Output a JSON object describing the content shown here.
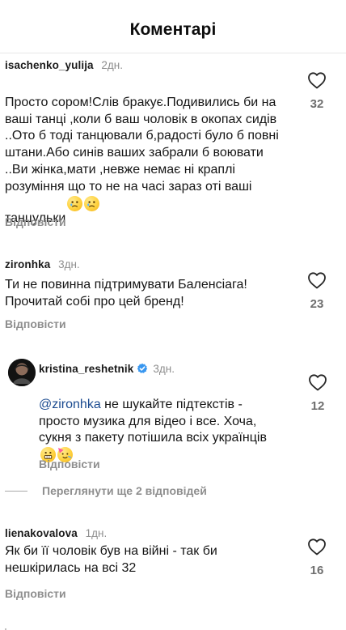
{
  "header": {
    "title": "Коментарі"
  },
  "comments": [
    {
      "username": "isachenko_yulija",
      "time": "2дн.",
      "text": "Просто сором!Слів бракує.Подивились би на ваші танці ,коли б ваш чоловік в окопах сидів ..Ото б тоді танцювали б,радості було б повні штани.Або синів ваших забрали б воювати ..Ви жінка,мати ,невже немає ні краплі розуміння що то не на часі зараз оті ваші танцульки",
      "reply_label": "Відповісти",
      "likes": "32"
    },
    {
      "username": "zironhka",
      "time": "3дн.",
      "text": "Ти не повинна підтримувати Баленсіага! Прочитай собі про цей бренд!",
      "reply_label": "Відповісти",
      "likes": "23"
    },
    {
      "username": "kristina_reshetnik",
      "time": "3дн.",
      "mention": "@zironhka",
      "text": " не шукайте підтекстів - просто музика для відео і все. Хоча, сукня з пакету потішила всіх українців",
      "reply_label": "Відповісти",
      "likes": "12"
    },
    {
      "username": "lienakovalova",
      "time": "1дн.",
      "text": "Як би її чоловік був на війні - так би нешкірилась на всі 32",
      "reply_label": "Відповісти",
      "likes": "16"
    }
  ],
  "view_replies": {
    "label": "Переглянути ще 2 відповідей"
  },
  "colors": {
    "mention": "#1a4a8f",
    "verified": "#3897f0",
    "secondary_text": "#8e8e8e"
  },
  "icons": {
    "like": "heart-outline-icon",
    "verified": "verified-badge-icon",
    "avatar": "profile-avatar"
  }
}
